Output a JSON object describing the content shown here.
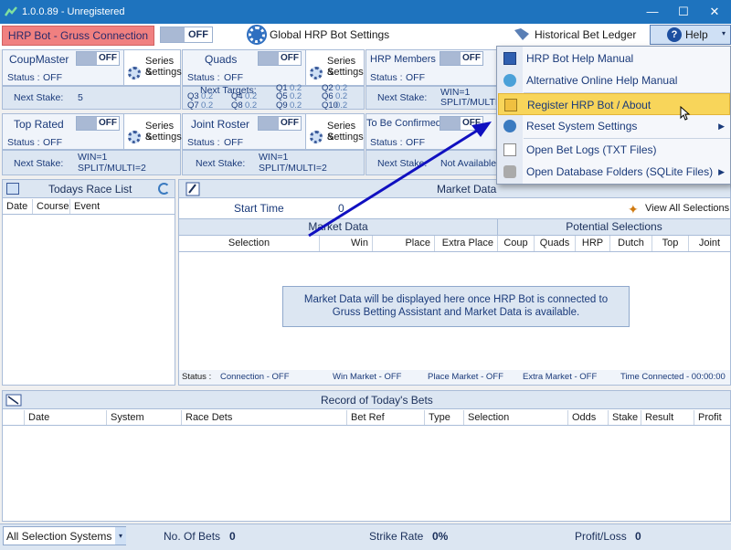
{
  "window": {
    "title": "1.0.0.89 - Unregistered",
    "minimize": "—",
    "maximize": "☐",
    "close": "✕"
  },
  "topbar": {
    "connection_label": "HRP Bot - Gruss Connection",
    "connection_toggle": "OFF",
    "global_settings": "Global HRP Bot Settings",
    "ledger": "Historical Bet Ledger",
    "help": "Help"
  },
  "panels": {
    "coupmaster": {
      "name": "CoupMaster",
      "toggle": "OFF",
      "status_label": "Status :",
      "status": "OFF",
      "series": "Series &",
      "settings": "Settings",
      "stake_label": "Next Stake:",
      "stake": "5"
    },
    "quads": {
      "name": "Quads",
      "toggle": "OFF",
      "status_label": "Status :",
      "status": "OFF",
      "series": "Series &",
      "settings": "Settings",
      "targets_label": "Next Targets:",
      "q3": "Q3",
      "q3v": "0.2",
      "q4": "Q4",
      "q4v": "0.2",
      "q1": "Q1",
      "q1v": "0.2",
      "q2": "Q2",
      "q2v": "0.2",
      "q7": "Q7",
      "q7v": "0.2",
      "q8": "Q8",
      "q8v": "0.2",
      "q5": "Q5",
      "q5v": "0.2",
      "q6": "Q6",
      "q6v": "0.2",
      "q9": "Q9",
      "q9v": "0.2",
      "q10": "Q10",
      "q10v": "0.2"
    },
    "hrp_members": {
      "name": "HRP Members",
      "toggle": "OFF",
      "status_label": "Status :",
      "status": "OFF",
      "stake_label": "Next Stake:",
      "stake1": "WIN=1",
      "stake2": "SPLIT/MULTI"
    },
    "top_rated": {
      "name": "Top Rated",
      "toggle": "OFF",
      "status_label": "Status :",
      "status": "OFF",
      "series": "Series &",
      "settings": "Settings",
      "stake_label": "Next Stake:",
      "stake1": "WIN=1",
      "stake2": "SPLIT/MULTI=2"
    },
    "joint_roster": {
      "name": "Joint Roster",
      "toggle": "OFF",
      "status_label": "Status :",
      "status": "OFF",
      "series": "Series &",
      "settings": "Settings",
      "stake_label": "Next Stake:",
      "stake1": "WIN=1",
      "stake2": "SPLIT/MULTI=2"
    },
    "to_be_confirmed": {
      "name": "To Be Confirmed",
      "toggle": "OFF",
      "status_label": "Status :",
      "status": "OFF",
      "stake_label": "Next Stake:",
      "stake": "Not Available"
    }
  },
  "race_list": {
    "title": "Todays Race List",
    "columns": [
      "Date",
      "Course",
      "Event"
    ]
  },
  "market": {
    "title": "Market Data",
    "start_time_label": "Start Time",
    "start_time": "0",
    "view_all": "View All Selections",
    "section_market": "Market Data",
    "section_potential": "Potential Selections",
    "columns": [
      "Selection",
      "Win",
      "Place",
      "Extra Place",
      "Coup",
      "Quads",
      "HRP",
      "Dutch",
      "Top",
      "Joint"
    ],
    "message_line1": "Market Data will be displayed here once HRP Bot is connected to",
    "message_line2": "Gruss Betting Assistant and Market Data is available.",
    "status_label": "Status :",
    "conn": "Connection - OFF",
    "win_market": "Win Market - OFF",
    "place_market": "Place Market - OFF",
    "extra_market": "Extra Market - OFF",
    "time_connected": "Time Connected - 00:00:00"
  },
  "bets": {
    "title": "Record of Today's Bets",
    "columns": [
      "Date",
      "System",
      "Race Dets",
      "Bet Ref",
      "Type",
      "Selection",
      "Odds",
      "Stake",
      "Result",
      "Profit"
    ]
  },
  "footer": {
    "filter": "All Selection Systems",
    "no_bets_label": "No. Of Bets",
    "no_bets": "0",
    "strike_label": "Strike Rate",
    "strike": "0%",
    "pl_label": "Profit/Loss",
    "pl": "0"
  },
  "help_menu": {
    "items": [
      {
        "label": "HRP Bot Help Manual"
      },
      {
        "label": "Alternative Online Help Manual"
      },
      {
        "label": "Register HRP Bot / About"
      },
      {
        "label": "Reset System Settings"
      },
      {
        "label": "Open Bet Logs (TXT Files)"
      },
      {
        "label": "Open Database Folders (SQLite Files)"
      }
    ]
  },
  "colors": {
    "titlebar": "#1e73be",
    "connection": "#f08080",
    "highlight": "#f8d55a",
    "arrow": "#1010c0"
  }
}
